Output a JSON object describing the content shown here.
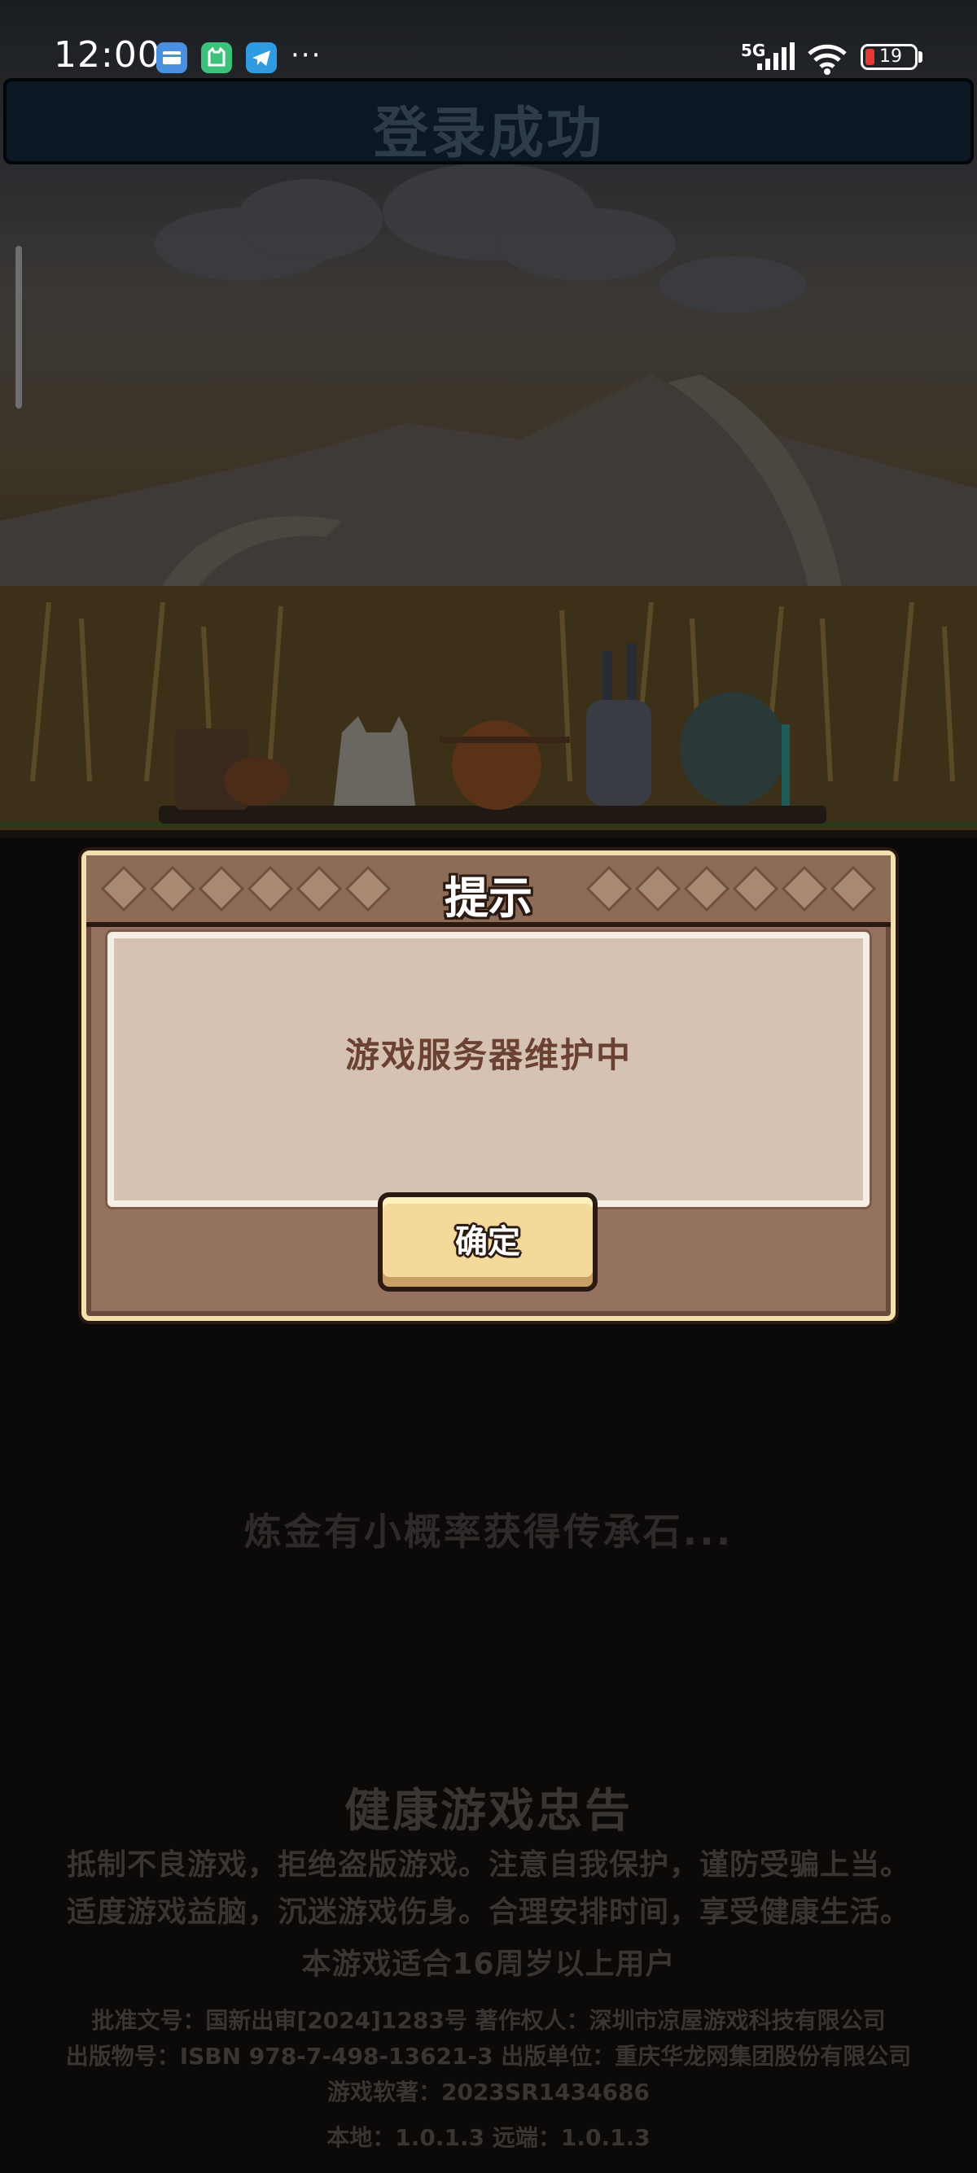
{
  "status_bar": {
    "time": "12:00",
    "network": "5G",
    "battery": "19",
    "more": "···",
    "app_icons": [
      "mail-icon",
      "cat-app-icon",
      "telegram-icon"
    ]
  },
  "scene": {
    "login_banner": "登录成功"
  },
  "dialog": {
    "title": "提示",
    "message": "游戏服务器维护中",
    "confirm_label": "确定"
  },
  "loading_tip": "炼金有小概率获得传承石...",
  "health_notice": {
    "title": "健康游戏忠告",
    "line1": "抵制不良游戏，拒绝盗版游戏。注意自我保护，谨防受骗上当。",
    "line2": "适度游戏益脑，沉迷游戏伤身。合理安排时间，享受健康生活。",
    "age_rating": "本游戏适合16周岁以上用户"
  },
  "publishing_info": {
    "line1": "批准文号：国新出审[2024]1283号   著作权人：深圳市凉屋游戏科技有限公司",
    "line2": "出版物号：ISBN 978-7-498-13621-3   出版单位：重庆华龙网集团股份有限公司",
    "line3": "游戏软著：2023SR1434686",
    "version": "本地：1.0.1.3  远端：1.0.1.3"
  },
  "colors": {
    "dialog_border": "#f2e1ad",
    "dialog_body": "#94725f",
    "panel": "#d6c2b2",
    "message_text": "#6b4232",
    "button": "#f3d99a"
  }
}
